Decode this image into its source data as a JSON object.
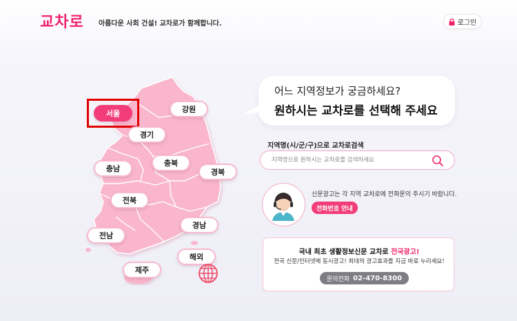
{
  "header": {
    "logo": "교차로",
    "tagline": "아름다운 사회 건설! 교차로가 함께합니다.",
    "login_label": "로그인",
    "login_icon": "lock-icon"
  },
  "map": {
    "regions": {
      "seoul": "서울",
      "gangwon": "강원",
      "gyeonggi": "경기",
      "chungnam": "충남",
      "chungbuk": "충북",
      "gyeongbuk": "경북",
      "jeonbuk": "전북",
      "gyeongnam": "경남",
      "jeonnam": "전남",
      "overseas": "해외",
      "jeju": "제주"
    },
    "selected": "서울",
    "colors": {
      "map_fill": "#f9b6cc",
      "active": "#f23d7a"
    }
  },
  "bubble": {
    "line1": "어느 지역정보가 궁금하세요?",
    "line2": "원하시는 교차로를 선택해 주세요"
  },
  "search": {
    "label": "지역명(시/군/구)으로 교차로검색",
    "placeholder": "지역명으로 원하시는 교차로를 검색하세요"
  },
  "notice": {
    "text": "신문광고는 각 지역 교차로에 전화문의 주시기 바랍니다.",
    "button": "전화번호 안내"
  },
  "ad": {
    "title_main": "국내 최초 생활정보신문 교차로",
    "title_highlight": "전국광고!",
    "description": "전국 신문/인터넷에 동시광고! 최대의 광고효과를 지금 바로 누리세요!",
    "phone_label": "문의전화",
    "phone_number": "02-470-8300"
  },
  "colors": {
    "brand": "#f0246a",
    "accent_border": "#f2a8c4"
  }
}
